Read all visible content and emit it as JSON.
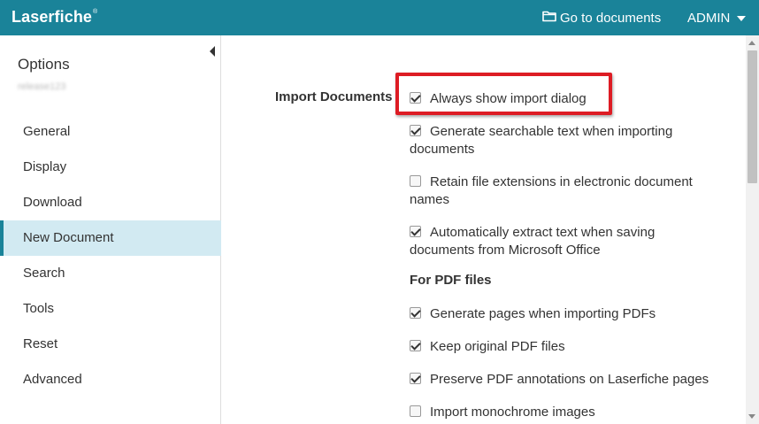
{
  "header": {
    "logo": "Laserfiche",
    "logo_mark": "®",
    "goto_label": "Go to documents",
    "goto_icon": "folder-icon",
    "user_label": "ADMIN",
    "colors": {
      "bar": "#1a8399",
      "text": "#ffffff"
    }
  },
  "sidebar": {
    "title": "Options",
    "subtitle": "release123",
    "items": [
      {
        "label": "General"
      },
      {
        "label": "Display"
      },
      {
        "label": "Download"
      },
      {
        "label": "New Document",
        "active": true
      },
      {
        "label": "Search"
      },
      {
        "label": "Tools"
      },
      {
        "label": "Reset"
      },
      {
        "label": "Advanced"
      }
    ],
    "active_color": "#d2eaf2"
  },
  "main": {
    "section_label": "Import Documents",
    "options": [
      {
        "label": "Always show import dialog",
        "checked": true
      },
      {
        "label": "Generate searchable text when importing documents",
        "checked": true
      },
      {
        "label": "Retain file extensions in electronic document names",
        "checked": false
      },
      {
        "label": "Automatically extract text when saving documents from Microsoft Office",
        "checked": true
      }
    ],
    "pdf_heading": "For PDF files",
    "pdf_options": [
      {
        "label": "Generate pages when importing PDFs",
        "checked": true
      },
      {
        "label": "Keep original PDF files",
        "checked": true
      },
      {
        "label": "Preserve PDF annotations on Laserfiche pages",
        "checked": true
      },
      {
        "label": "Import monochrome images",
        "checked": false
      }
    ],
    "highlight_color": "#dd1c24"
  }
}
